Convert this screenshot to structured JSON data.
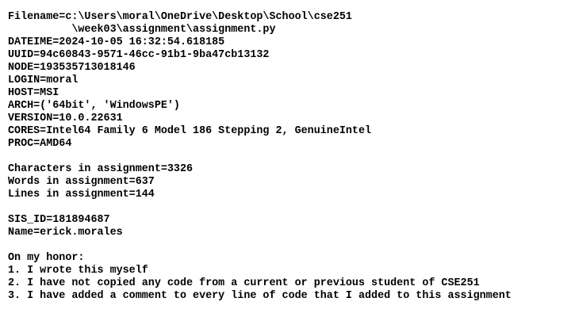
{
  "header": {
    "filename": "Filename=c:\\Users\\moral\\OneDrive\\Desktop\\School\\cse251",
    "filename_cont": "          \\week03\\assignment\\assignment.py",
    "dateime": "DATEIME=2024-10-05 16:32:54.618185",
    "uuid": "UUID=94c60843-9571-46cc-91b1-9ba47cb13132",
    "node": "NODE=193535713018146",
    "login": "LOGIN=moral",
    "host": "HOST=MSI",
    "arch": "ARCH=('64bit', 'WindowsPE')",
    "version": "VERSION=10.0.22631",
    "cores": "CORES=Intel64 Family 6 Model 186 Stepping 2, GenuineIntel",
    "proc": "PROC=AMD64"
  },
  "stats": {
    "characters": "Characters in assignment=3326",
    "words": "Words in assignment=637",
    "lines": "Lines in assignment=144"
  },
  "student": {
    "sis_id": "SIS_ID=181894687",
    "name": "Name=erick.morales"
  },
  "honor": {
    "heading": "On my honor:",
    "items": [
      "1. I wrote this myself",
      "2. I have not copied any code from a current or previous student of CSE251",
      "3. I have added a comment to every line of code that I added to this assignment"
    ]
  }
}
